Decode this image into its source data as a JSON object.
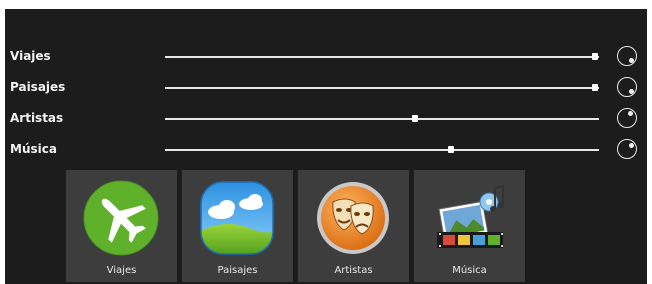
{
  "rows": [
    {
      "label": "Viajes",
      "level": 1.0
    },
    {
      "label": "Paisajes",
      "level": 1.0
    },
    {
      "label": "Artistas",
      "level": 0.58
    },
    {
      "label": "Música",
      "level": 0.66
    }
  ],
  "tiles": [
    {
      "label": "Viajes",
      "icon": "airplane-icon"
    },
    {
      "label": "Paisajes",
      "icon": "landscape-icon"
    },
    {
      "label": "Artistas",
      "icon": "theater-masks-icon"
    },
    {
      "label": "Música",
      "icon": "film-music-icon"
    }
  ],
  "colors": {
    "background": "#1c1c1c",
    "tile": "#3d3d3d",
    "track": "#e6e6e6",
    "airplane_green": "#5fb02b",
    "masks_orange": "#e8872a"
  }
}
